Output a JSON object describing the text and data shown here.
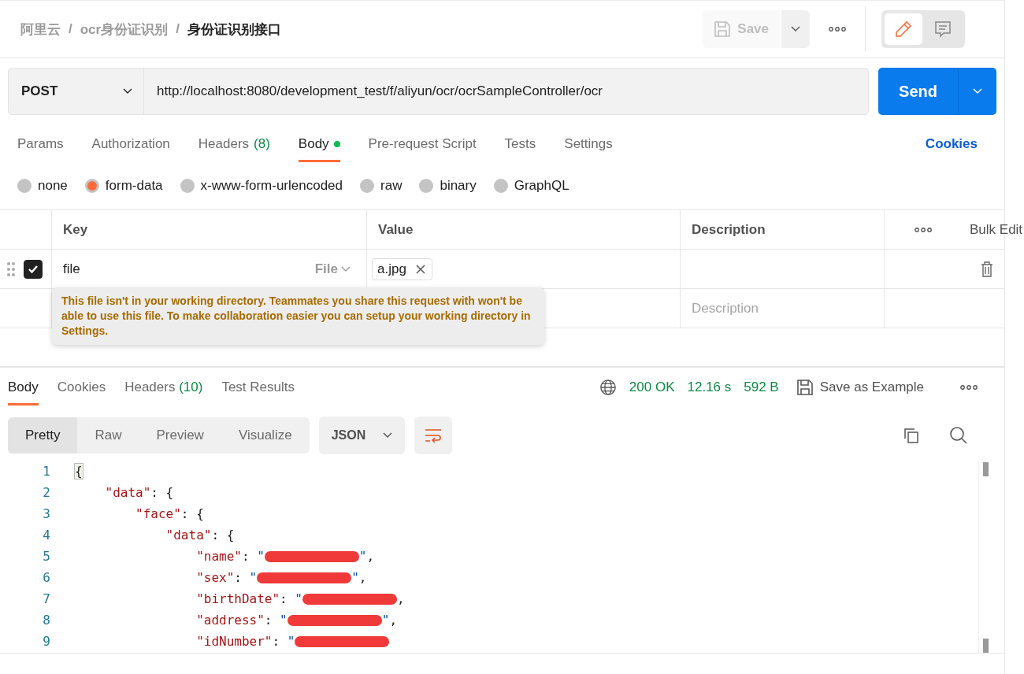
{
  "breadcrumb": [
    {
      "label": "阿里云",
      "current": false
    },
    {
      "label": "ocr身份证识别",
      "current": false
    },
    {
      "label": "身份证识别接口",
      "current": true
    }
  ],
  "breadcrumb_separator": "/",
  "header": {
    "save_label": "Save",
    "save_disabled": true,
    "modes": [
      {
        "kind": "edit",
        "selected": true
      },
      {
        "kind": "comments",
        "selected": false
      }
    ]
  },
  "request": {
    "method": "POST",
    "url": "http://localhost:8080/development_test/f/aliyun/ocr/ocrSampleController/ocr",
    "send_label": "Send"
  },
  "request_tabs": [
    {
      "label": "Params",
      "dot": false,
      "selected": false
    },
    {
      "label": "Authorization",
      "dot": false,
      "selected": false
    },
    {
      "label": "Headers",
      "count": "(8)",
      "dot": false,
      "selected": false
    },
    {
      "label": "Body",
      "dot": true,
      "selected": true
    },
    {
      "label": "Pre-request Script",
      "dot": false,
      "selected": false
    },
    {
      "label": "Tests",
      "dot": false,
      "selected": false
    },
    {
      "label": "Settings",
      "dot": false,
      "selected": false
    }
  ],
  "cookies_link": "Cookies",
  "body_types": [
    {
      "label": "none",
      "selected": false
    },
    {
      "label": "form-data",
      "selected": true
    },
    {
      "label": "x-www-form-urlencoded",
      "selected": false
    },
    {
      "label": "raw",
      "selected": false
    },
    {
      "label": "binary",
      "selected": false
    },
    {
      "label": "GraphQL",
      "selected": false
    }
  ],
  "form_table": {
    "columns": [
      "Key",
      "Value",
      "Description"
    ],
    "bulk_edit": "Bulk Edit",
    "rows": [
      {
        "checked": true,
        "key": "file",
        "type": "File",
        "file_chip": "a.jpg"
      }
    ],
    "new_row": {
      "description_placeholder": "Description"
    },
    "tooltip": "This file isn't in your working directory. Teammates you share this request with won't be able to use this file. To make collaboration easier you can setup your working directory in Settings."
  },
  "response_tabs": [
    {
      "label": "Body",
      "selected": true
    },
    {
      "label": "Cookies",
      "selected": false
    },
    {
      "label": "Headers",
      "count": "(10)",
      "selected": false
    },
    {
      "label": "Test Results",
      "selected": false
    }
  ],
  "response_meta": {
    "status": "200 OK",
    "time": "12.16 s",
    "size": "592 B",
    "save_example": "Save as Example"
  },
  "view_modes": [
    {
      "label": "Pretty",
      "selected": true
    },
    {
      "label": "Raw",
      "selected": false
    },
    {
      "label": "Preview",
      "selected": false
    },
    {
      "label": "Visualize",
      "selected": false
    }
  ],
  "format": "JSON",
  "code_lines": [
    {
      "number": "1",
      "tokens": [
        {
          "kind": "brace",
          "text": "{"
        }
      ]
    },
    {
      "number": "2",
      "tokens": [
        {
          "kind": "key",
          "text": "    \"data\""
        },
        {
          "kind": "punct",
          "text": ": {"
        }
      ]
    },
    {
      "number": "3",
      "tokens": [
        {
          "kind": "key",
          "text": "        \"face\""
        },
        {
          "kind": "punct",
          "text": ": {"
        }
      ]
    },
    {
      "number": "4",
      "tokens": [
        {
          "kind": "key",
          "text": "            \"data\""
        },
        {
          "kind": "punct",
          "text": ": {"
        }
      ]
    },
    {
      "number": "5",
      "tokens": [
        {
          "kind": "key",
          "text": "                \"name\""
        },
        {
          "kind": "punct",
          "text": ": "
        },
        {
          "kind": "string",
          "text": "\""
        },
        {
          "kind": "redacted"
        },
        {
          "kind": "string",
          "text": "\""
        },
        {
          "kind": "punct",
          "text": ","
        }
      ]
    },
    {
      "number": "6",
      "tokens": [
        {
          "kind": "key",
          "text": "                \"sex\""
        },
        {
          "kind": "punct",
          "text": ": "
        },
        {
          "kind": "string",
          "text": "\""
        },
        {
          "kind": "redacted"
        },
        {
          "kind": "string",
          "text": "\""
        },
        {
          "kind": "punct",
          "text": ","
        }
      ]
    },
    {
      "number": "7",
      "tokens": [
        {
          "kind": "key",
          "text": "                \"birthDate\""
        },
        {
          "kind": "punct",
          "text": ": "
        },
        {
          "kind": "string",
          "text": "\""
        },
        {
          "kind": "redacted"
        },
        {
          "kind": "punct",
          "text": ","
        }
      ]
    },
    {
      "number": "8",
      "tokens": [
        {
          "kind": "key",
          "text": "                \"address\""
        },
        {
          "kind": "punct",
          "text": ": "
        },
        {
          "kind": "string",
          "text": "\""
        },
        {
          "kind": "redacted"
        },
        {
          "kind": "string",
          "text": "\""
        },
        {
          "kind": "punct",
          "text": ","
        }
      ]
    },
    {
      "number": "9",
      "tokens": [
        {
          "kind": "key",
          "text": "                \"idNumber\""
        },
        {
          "kind": "punct",
          "text": ": "
        },
        {
          "kind": "string",
          "text": "\""
        },
        {
          "kind": "redacted"
        }
      ]
    }
  ]
}
